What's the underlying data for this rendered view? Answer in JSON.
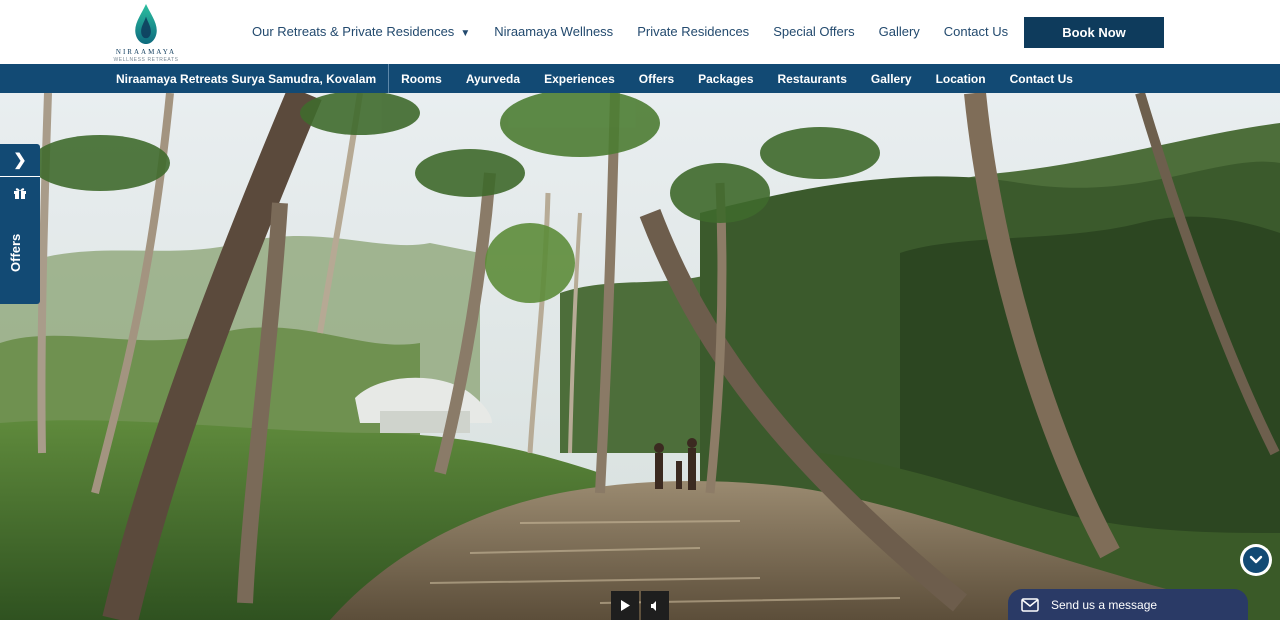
{
  "brand": {
    "name": "NIRAAMAYA",
    "tagline": "WELLNESS RETREATS"
  },
  "main_nav": {
    "items": [
      {
        "label": "Our Retreats & Private Residences",
        "has_dropdown": true
      },
      {
        "label": "Niraamaya Wellness"
      },
      {
        "label": "Private Residences"
      },
      {
        "label": "Special Offers"
      },
      {
        "label": "Gallery"
      },
      {
        "label": "Contact Us"
      }
    ],
    "menu_icon": "hamburger-icon",
    "book_label": "Book Now"
  },
  "sub_nav": {
    "title": "Niraamaya Retreats Surya Samudra, Kovalam",
    "items": [
      "Rooms",
      "Ayurveda",
      "Experiences",
      "Offers",
      "Packages",
      "Restaurants",
      "Gallery",
      "Location",
      "Contact Us"
    ]
  },
  "offers_tab": {
    "label": "Offers",
    "icons": [
      "chevron-right-icon",
      "gift-icon"
    ]
  },
  "video": {
    "controls": [
      "play-icon",
      "mute-icon"
    ]
  },
  "chat": {
    "label": "Send us a message",
    "icon": "mail-icon"
  },
  "scroll_down": {
    "icon": "chevron-down-icon"
  },
  "colors": {
    "primary_navy": "#0e3b5c",
    "subnav_blue": "#124a74",
    "nav_text": "#234a6e",
    "chat_bg": "#2a3a66",
    "logo_teal": "#1aa58f"
  }
}
